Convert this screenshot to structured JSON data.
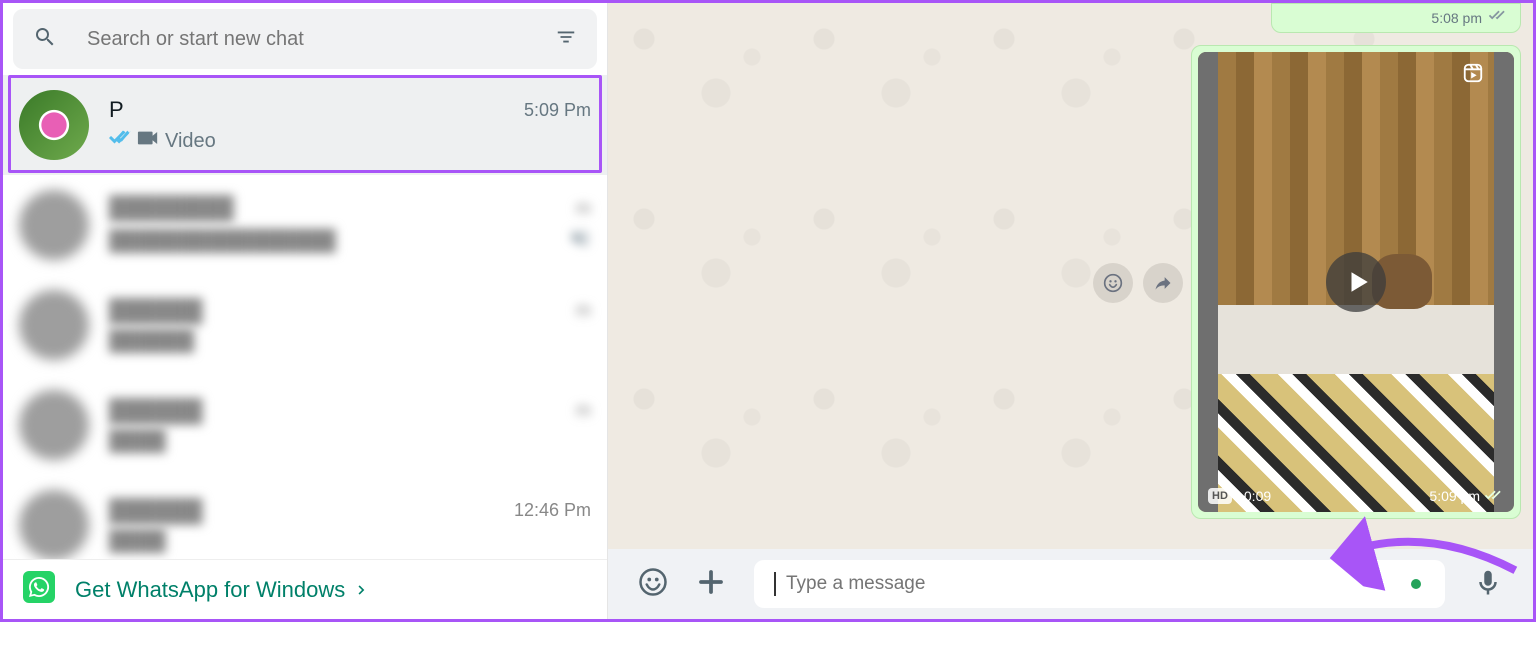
{
  "search": {
    "placeholder": "Search or start new chat"
  },
  "chats": {
    "selected": {
      "name": "P",
      "time": "5:09 Pm",
      "preview_label": "Video"
    },
    "blur2_time": "m",
    "blur3_time": "m",
    "blur4_time": "m",
    "last_time": "12:46 Pm"
  },
  "promo": {
    "text": "Get WhatsApp for Windows"
  },
  "convo": {
    "prev_msg_time": "5:08 pm",
    "video": {
      "duration": "0:09",
      "hd": "HD",
      "time": "5:09 pm"
    }
  },
  "composer": {
    "placeholder": "Type a message"
  }
}
